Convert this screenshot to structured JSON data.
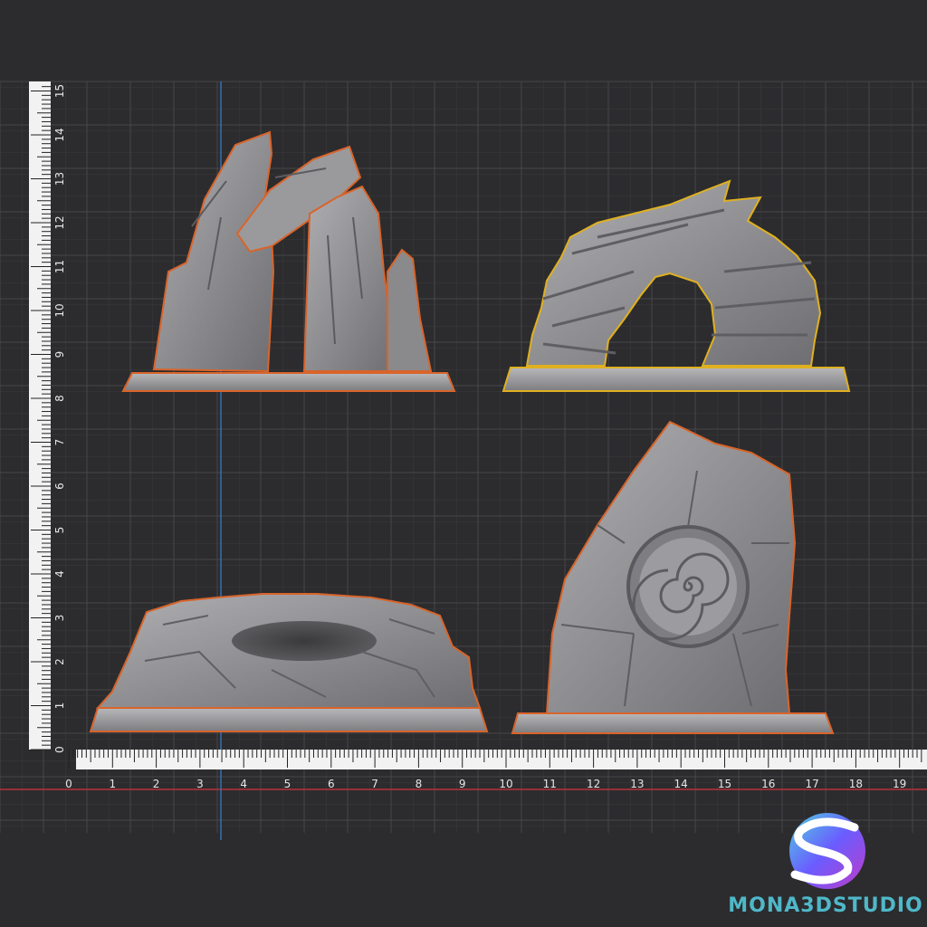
{
  "viewport": {
    "ruler_horizontal": {
      "label": "horizontal-ruler",
      "tick_labels": [
        "0",
        "1",
        "2",
        "3",
        "4",
        "5",
        "6",
        "7",
        "8",
        "9",
        "10",
        "11",
        "12",
        "13",
        "14",
        "15",
        "16",
        "17",
        "18",
        "19"
      ]
    },
    "ruler_vertical": {
      "label": "vertical-ruler",
      "tick_labels": [
        "0",
        "1",
        "2",
        "3",
        "4",
        "5",
        "6",
        "7",
        "8",
        "9",
        "10",
        "11",
        "12",
        "13",
        "14",
        "15"
      ]
    },
    "models": [
      {
        "name": "leaning-stone-arch",
        "outline_color": "#d9642a"
      },
      {
        "name": "layered-rock-arch",
        "outline_color": "#e0b020"
      },
      {
        "name": "rock-cave-mound",
        "outline_color": "#d9642a"
      },
      {
        "name": "spiral-rune-monolith",
        "outline_color": "#d9642a"
      }
    ],
    "colors": {
      "background": "#2c2c2e",
      "grid_minor": "#3c3c3f",
      "grid_major": "#4a4a4d",
      "axis_x": "#b8323c",
      "axis_y": "#3a6fb0",
      "stone": "#8f8f92",
      "base": "#a3a3a6"
    }
  },
  "watermark": {
    "brand": "MONA3DSTUDIO",
    "logo_icon": "sphere-s-logo-icon"
  }
}
